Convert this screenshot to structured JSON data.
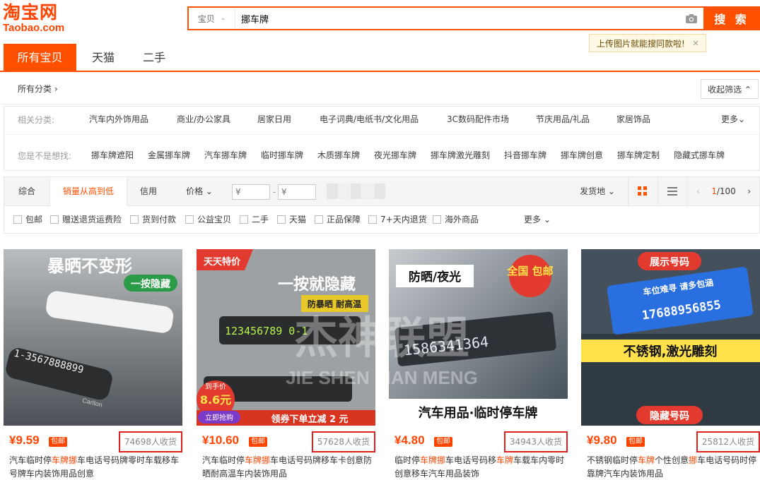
{
  "logo": {
    "cn": "淘宝网",
    "en": "Taobao.com"
  },
  "search": {
    "category": "宝贝",
    "query": "挪车牌",
    "button": "搜 索",
    "tip": "上传图片就能搜同款啦!",
    "tip_close": "×"
  },
  "tabs": [
    "所有宝贝",
    "天猫",
    "二手"
  ],
  "all_categories": "所有分类 ›",
  "collapse_filter": "收起筛选 ⌃",
  "related": {
    "label": "相关分类:",
    "items": [
      "汽车内外饰用品",
      "商业/办公家具",
      "居家日用",
      "电子词典/电纸书/文化用品",
      "3C数码配件市场",
      "节庆用品/礼品",
      "家居饰品"
    ],
    "more": "更多⌄"
  },
  "suggest": {
    "label": "您是不是想找:",
    "items": [
      "挪车牌遮阳",
      "金属挪车牌",
      "汽车挪车牌",
      "临时挪车牌",
      "木质挪车牌",
      "夜光挪车牌",
      "挪车牌激光雕刻",
      "抖音挪车牌",
      "挪车牌创意",
      "挪车牌定制",
      "隐藏式挪车牌"
    ]
  },
  "sort": {
    "items": [
      "综合",
      "销量从高到低",
      "信用",
      "价格 ⌄"
    ],
    "active_index": 1,
    "price_min_placeholder": "¥",
    "price_max_placeholder": "¥",
    "price_dash": "-",
    "location": "发货地 ⌄",
    "pager": {
      "current": "1",
      "total": "/100"
    }
  },
  "filters": [
    "包邮",
    "赠送退货运费险",
    "货到付款",
    "公益宝贝",
    "二手",
    "天猫",
    "正品保障",
    "7+天内退货",
    "海外商品"
  ],
  "filters_more": "更多 ⌄",
  "products": [
    {
      "price": "¥9.59",
      "badge": "包邮",
      "sold": "74698人收货",
      "title_parts": [
        "汽车临时停",
        "车牌挪",
        "车电话号码牌零时车载移车号牌车内装饰用品创意"
      ],
      "img_text": [
        "暴晒不变形",
        "一按隐藏",
        "1-3567888899",
        "Carlton"
      ],
      "colors": {
        "bg": "#6d7378",
        "accent": "#2a9b47"
      }
    },
    {
      "price": "¥10.60",
      "badge": "包邮",
      "sold": "57628人收货",
      "title_parts": [
        "汽车临时停",
        "车牌挪",
        "车电话号码牌移车卡创意防晒耐高温车内装饰用品"
      ],
      "img_text": [
        "天天特价",
        "一按就隐藏",
        "防暴晒 耐高温",
        "123456789 0-1",
        "到手价",
        "8.6元",
        "立即抢购",
        "领券下单立减 2 元"
      ],
      "colors": {
        "bg": "#8c8f92",
        "accent": "#e23a2f"
      }
    },
    {
      "price": "¥4.80",
      "badge": "包邮",
      "sold": "34943人收货",
      "title_parts": [
        "临时停",
        "车牌挪",
        "车电话号码移",
        "车牌",
        "车载车内零时创意移车汽车用品装饰"
      ],
      "img_text": [
        "防晒/夜光",
        "全国 包邮",
        "1586341364",
        "汽车用品·临时停车牌"
      ],
      "colors": {
        "bg": "#53616c",
        "accent": "#e23a2f"
      }
    },
    {
      "price": "¥9.80",
      "badge": "包邮",
      "sold": "25812人收货",
      "title_parts": [
        "不锈钢临时停",
        "车牌",
        "个性创意",
        "挪",
        "车电话号码时停靠牌汽车内装饰用品"
      ],
      "img_text": [
        "展示号码",
        "车位难寻 请多包涵",
        "17688956855",
        "不锈钢,激光雕刻",
        "隐藏号码"
      ],
      "colors": {
        "bg": "#3d4a55",
        "accent": "#e23a2f"
      }
    }
  ],
  "watermark": {
    "cn": "杰神联盟",
    "en": "JIE SHEN LIAN MENG"
  }
}
